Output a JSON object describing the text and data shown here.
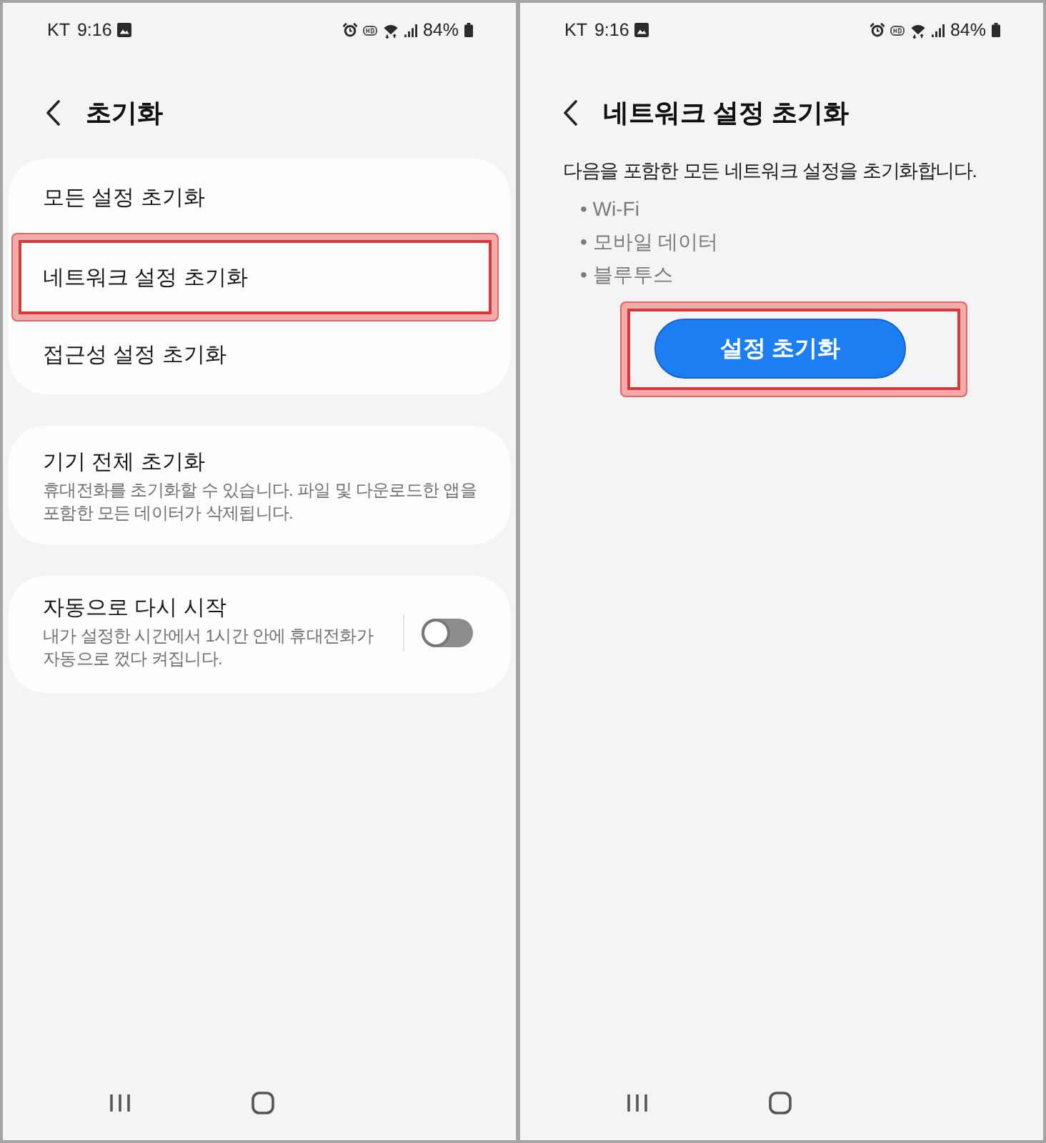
{
  "screens": [
    {
      "kind": "menu",
      "status_bar": {
        "carrier": "KT",
        "time": "9:16",
        "battery": "84%"
      },
      "title": "초기화",
      "groups": [
        {
          "items": [
            {
              "label": "모든 설정 초기화",
              "highlighted": false
            },
            {
              "label": "네트워크 설정 초기화",
              "highlighted": true
            },
            {
              "label": "접근성 설정 초기화",
              "highlighted": false
            }
          ]
        },
        {
          "items": [
            {
              "label": "기기 전체 초기화",
              "description": "휴대전화를 초기화할 수 있습니다. 파일 및 다운로드한 앱을 포함한 모든 데이터가 삭제됩니다."
            }
          ]
        },
        {
          "items": [
            {
              "label": "자동으로 다시 시작",
              "description": "내가 설정한 시간에서 1시간 안에 휴대전화가 자동으로 껐다 켜집니다.",
              "toggle": {
                "on": false
              }
            }
          ]
        }
      ]
    },
    {
      "kind": "detail",
      "status_bar": {
        "carrier": "KT",
        "time": "9:16",
        "battery": "84%"
      },
      "title": "네트워크 설정 초기화",
      "description": "다음을 포함한 모든 네트워크 설정을 초기화합니다.",
      "bullets": [
        "• Wi-Fi",
        "• 모바일 데이터",
        "• 블루투스"
      ],
      "button": {
        "label": "설정 초기화",
        "highlighted": true
      }
    }
  ]
}
